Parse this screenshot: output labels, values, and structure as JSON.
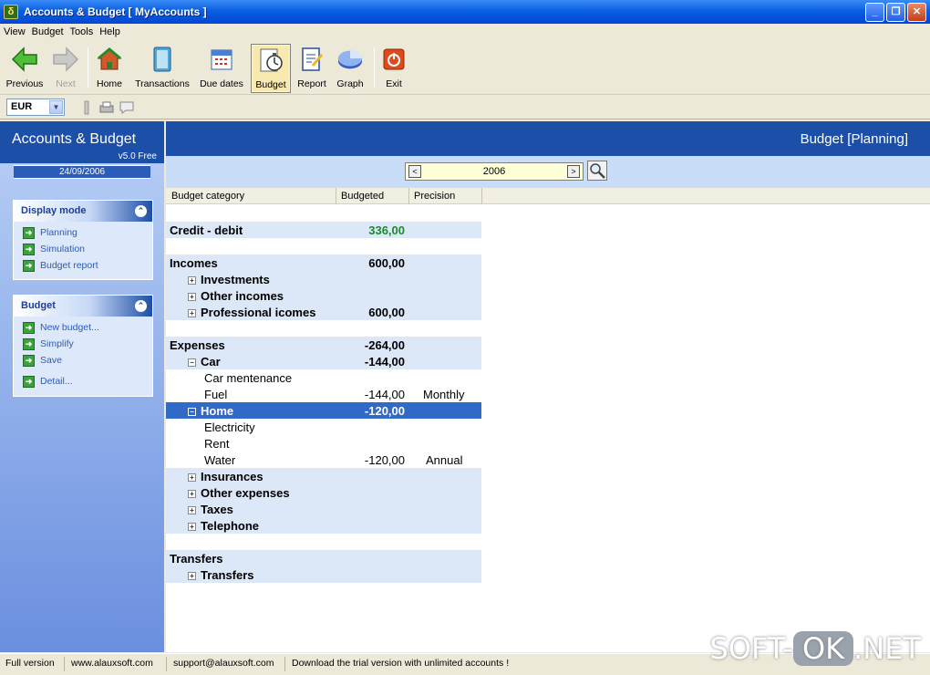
{
  "window": {
    "title": "Accounts & Budget [ MyAccounts ]"
  },
  "menu": [
    "View",
    "Budget",
    "Tools",
    "Help"
  ],
  "toolbar": {
    "previous": "Previous",
    "next": "Next",
    "home": "Home",
    "transactions": "Transactions",
    "due_dates": "Due dates",
    "budget": "Budget",
    "report": "Report",
    "graph": "Graph",
    "exit": "Exit"
  },
  "currency": "EUR",
  "sidebar": {
    "title": "Accounts & Budget",
    "version": "v5.0 Free",
    "date": "24/09/2006",
    "display_mode": {
      "header": "Display mode",
      "items": [
        "Planning",
        "Simulation",
        "Budget report"
      ]
    },
    "budget_panel": {
      "header": "Budget",
      "items": [
        "New budget...",
        "Simplify",
        "Save",
        "Detail..."
      ]
    }
  },
  "main": {
    "header": "Budget [Planning]",
    "year": "2006",
    "columns": [
      "Budget category",
      "Budgeted",
      "Precision"
    ],
    "rows": [
      {
        "category": "Credit - debit",
        "amount": "336,00",
        "precision": ""
      },
      {
        "category": "Incomes",
        "amount": "600,00",
        "precision": ""
      },
      {
        "category": "Investments",
        "amount": "",
        "precision": ""
      },
      {
        "category": "Other incomes",
        "amount": "",
        "precision": ""
      },
      {
        "category": "Professional icomes",
        "amount": "600,00",
        "precision": ""
      },
      {
        "category": "Expenses",
        "amount": "-264,00",
        "precision": ""
      },
      {
        "category": "Car",
        "amount": "-144,00",
        "precision": ""
      },
      {
        "category": "Car mentenance",
        "amount": "",
        "precision": ""
      },
      {
        "category": "Fuel",
        "amount": "-144,00",
        "precision": "Monthly"
      },
      {
        "category": "Home",
        "amount": "-120,00",
        "precision": ""
      },
      {
        "category": "Electricity",
        "amount": "",
        "precision": ""
      },
      {
        "category": "Rent",
        "amount": "",
        "precision": ""
      },
      {
        "category": "Water",
        "amount": "-120,00",
        "precision": "Annual"
      },
      {
        "category": "Insurances",
        "amount": "",
        "precision": ""
      },
      {
        "category": "Other expenses",
        "amount": "",
        "precision": ""
      },
      {
        "category": "Taxes",
        "amount": "",
        "precision": ""
      },
      {
        "category": "Telephone",
        "amount": "",
        "precision": ""
      },
      {
        "category": "Transfers",
        "amount": "",
        "precision": ""
      },
      {
        "category": "Transfers",
        "amount": "",
        "precision": ""
      }
    ]
  },
  "status": {
    "version": "Full version",
    "website": "www.alauxsoft.com",
    "email": "support@alauxsoft.com",
    "message": "Download the trial version with unlimited accounts !"
  },
  "watermark": {
    "left": "SOFT-",
    "box": "OK",
    "right": ".NET"
  }
}
